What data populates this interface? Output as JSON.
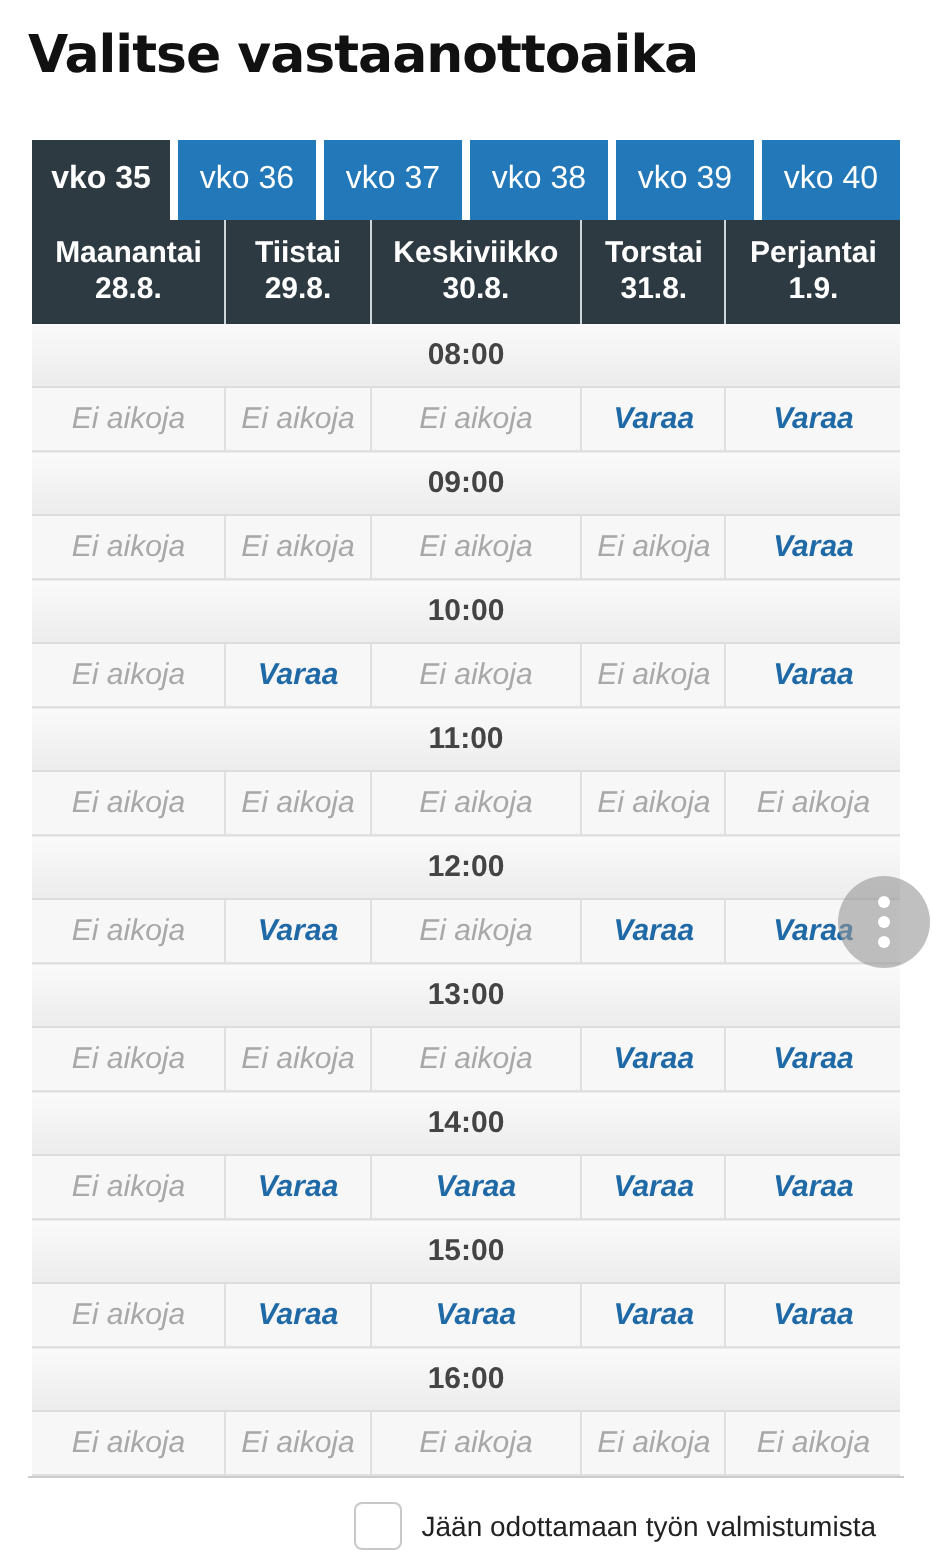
{
  "title": "Valitse vastaanottoaika",
  "tabs": [
    {
      "label": "vko 35",
      "selected": true
    },
    {
      "label": "vko 36",
      "selected": false
    },
    {
      "label": "vko 37",
      "selected": false
    },
    {
      "label": "vko 38",
      "selected": false
    },
    {
      "label": "vko 39",
      "selected": false
    },
    {
      "label": "vko 40",
      "selected": false
    }
  ],
  "days": [
    {
      "name": "Maanantai",
      "date": "28.8."
    },
    {
      "name": "Tiistai",
      "date": "29.8."
    },
    {
      "name": "Keskiviikko",
      "date": "30.8."
    },
    {
      "name": "Torstai",
      "date": "31.8."
    },
    {
      "name": "Perjantai",
      "date": "1.9."
    }
  ],
  "hours": [
    {
      "time": "08:00",
      "slots": [
        {
          "kind": "none",
          "text": "Ei aikoja"
        },
        {
          "kind": "none",
          "text": "Ei aikoja"
        },
        {
          "kind": "none",
          "text": "Ei aikoja"
        },
        {
          "kind": "free",
          "text": "Varaa"
        },
        {
          "kind": "free",
          "text": "Varaa"
        }
      ]
    },
    {
      "time": "09:00",
      "slots": [
        {
          "kind": "none",
          "text": "Ei aikoja"
        },
        {
          "kind": "none",
          "text": "Ei aikoja"
        },
        {
          "kind": "none",
          "text": "Ei aikoja"
        },
        {
          "kind": "none",
          "text": "Ei aikoja"
        },
        {
          "kind": "free",
          "text": "Varaa"
        }
      ]
    },
    {
      "time": "10:00",
      "slots": [
        {
          "kind": "none",
          "text": "Ei aikoja"
        },
        {
          "kind": "free",
          "text": "Varaa"
        },
        {
          "kind": "none",
          "text": "Ei aikoja"
        },
        {
          "kind": "none",
          "text": "Ei aikoja"
        },
        {
          "kind": "free",
          "text": "Varaa"
        }
      ]
    },
    {
      "time": "11:00",
      "slots": [
        {
          "kind": "none",
          "text": "Ei aikoja"
        },
        {
          "kind": "none",
          "text": "Ei aikoja"
        },
        {
          "kind": "none",
          "text": "Ei aikoja"
        },
        {
          "kind": "none",
          "text": "Ei aikoja"
        },
        {
          "kind": "none",
          "text": "Ei aikoja"
        }
      ]
    },
    {
      "time": "12:00",
      "slots": [
        {
          "kind": "none",
          "text": "Ei aikoja"
        },
        {
          "kind": "free",
          "text": "Varaa"
        },
        {
          "kind": "none",
          "text": "Ei aikoja"
        },
        {
          "kind": "free",
          "text": "Varaa"
        },
        {
          "kind": "free",
          "text": "Varaa"
        }
      ]
    },
    {
      "time": "13:00",
      "slots": [
        {
          "kind": "none",
          "text": "Ei aikoja"
        },
        {
          "kind": "none",
          "text": "Ei aikoja"
        },
        {
          "kind": "none",
          "text": "Ei aikoja"
        },
        {
          "kind": "free",
          "text": "Varaa"
        },
        {
          "kind": "free",
          "text": "Varaa"
        }
      ]
    },
    {
      "time": "14:00",
      "slots": [
        {
          "kind": "none",
          "text": "Ei aikoja"
        },
        {
          "kind": "free",
          "text": "Varaa"
        },
        {
          "kind": "free",
          "text": "Varaa"
        },
        {
          "kind": "free",
          "text": "Varaa"
        },
        {
          "kind": "free",
          "text": "Varaa"
        }
      ]
    },
    {
      "time": "15:00",
      "slots": [
        {
          "kind": "none",
          "text": "Ei aikoja"
        },
        {
          "kind": "free",
          "text": "Varaa"
        },
        {
          "kind": "free",
          "text": "Varaa"
        },
        {
          "kind": "free",
          "text": "Varaa"
        },
        {
          "kind": "free",
          "text": "Varaa"
        }
      ]
    },
    {
      "time": "16:00",
      "slots": [
        {
          "kind": "none",
          "text": "Ei aikoja"
        },
        {
          "kind": "none",
          "text": "Ei aikoja"
        },
        {
          "kind": "none",
          "text": "Ei aikoja"
        },
        {
          "kind": "none",
          "text": "Ei aikoja"
        },
        {
          "kind": "none",
          "text": "Ei aikoja"
        }
      ]
    }
  ],
  "wait_option": {
    "label": "Jään odottamaan työn valmistumista",
    "checked": false
  }
}
